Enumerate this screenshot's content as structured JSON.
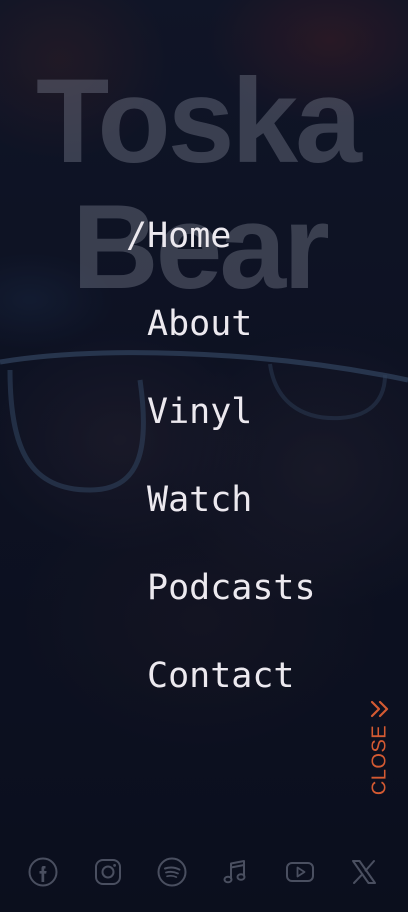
{
  "brand": {
    "line1": "Toska",
    "line2": "Bear"
  },
  "nav": {
    "active_prefix": "/",
    "items": [
      {
        "label": "Home",
        "active": true
      },
      {
        "label": "About",
        "active": false
      },
      {
        "label": "Vinyl",
        "active": false
      },
      {
        "label": "Watch",
        "active": false
      },
      {
        "label": "Podcasts",
        "active": false
      },
      {
        "label": "Contact",
        "active": false
      }
    ]
  },
  "close": {
    "label": "CLOSE",
    "icon": "double-chevron-right-icon",
    "color": "#d45a32"
  },
  "social": {
    "icon_color": "#4a4f60",
    "icons": [
      "facebook-icon",
      "instagram-icon",
      "spotify-icon",
      "apple-music-icon",
      "youtube-icon",
      "x-icon"
    ]
  },
  "colors": {
    "nav_text": "#ece9ef",
    "brand_text": "#787c8c",
    "background": "#101426"
  }
}
